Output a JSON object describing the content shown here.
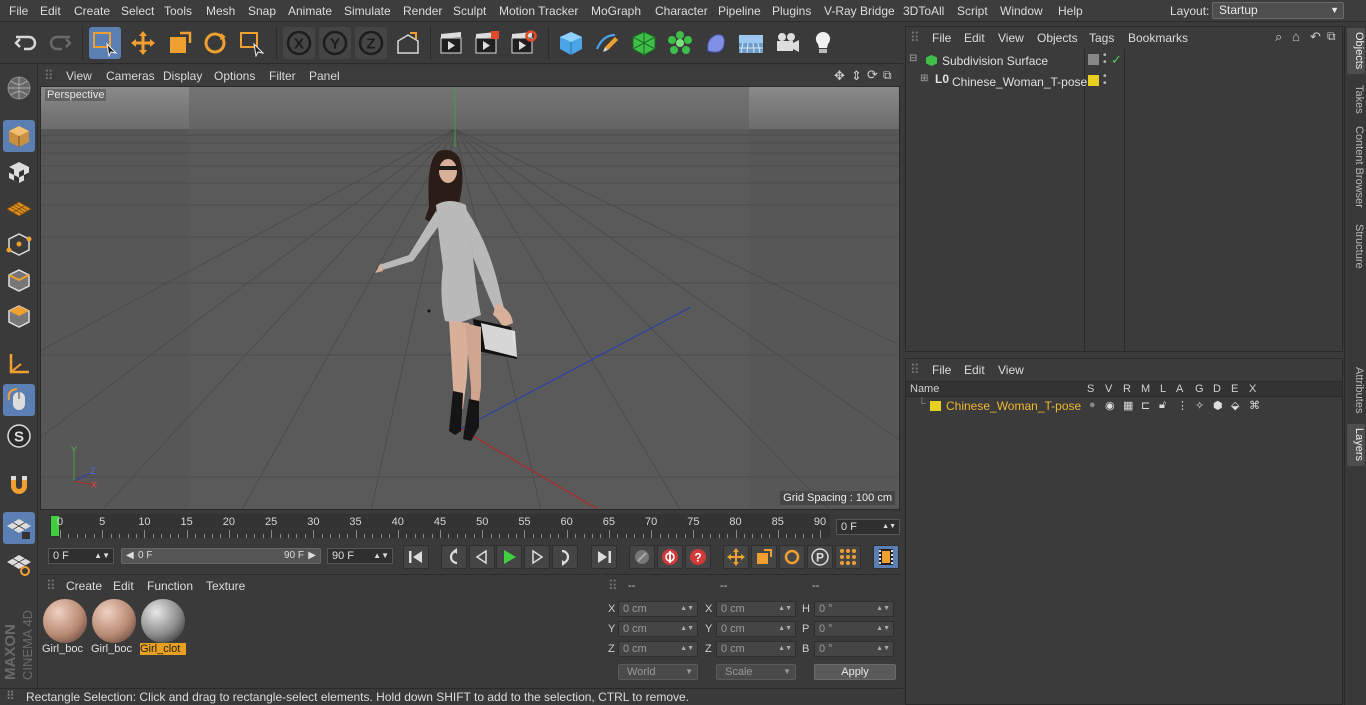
{
  "menubar": {
    "items": [
      "File",
      "Edit",
      "Create",
      "Select",
      "Tools",
      "Mesh",
      "Snap",
      "Animate",
      "Simulate",
      "Render",
      "Sculpt",
      "Motion Tracker",
      "MoGraph",
      "Character",
      "Pipeline",
      "Plugins",
      "V-Ray Bridge",
      "3DToAll",
      "Script",
      "Window",
      "Help"
    ],
    "layout_label": "Layout:",
    "layout_value": "Startup"
  },
  "toolbar": {
    "icons": [
      "undo-icon",
      "redo-icon",
      "rectangle-select-icon",
      "move-icon",
      "scale-icon",
      "rotate-icon",
      "live-select-icon",
      "x-axis-icon",
      "y-axis-icon",
      "z-axis-icon",
      "coordinate-system-icon",
      "render-view-icon",
      "render-picture-viewer-icon",
      "render-settings-icon",
      "cube-icon",
      "pen-icon",
      "subdivision-icon",
      "cloner-icon",
      "deformer-icon",
      "floor-icon",
      "camera-icon",
      "light-icon"
    ]
  },
  "viewport": {
    "menu": [
      "View",
      "Cameras",
      "Display",
      "Options",
      "Filter",
      "Panel"
    ],
    "label": "Perspective",
    "grid_spacing": "Grid Spacing : 100 cm"
  },
  "timeline": {
    "ticks": [
      "0",
      "5",
      "10",
      "15",
      "20",
      "25",
      "30",
      "35",
      "40",
      "45",
      "50",
      "55",
      "60",
      "65",
      "70",
      "75",
      "80",
      "85",
      "90"
    ],
    "current_frame": "0 F"
  },
  "transport": {
    "start_frame": "0 F",
    "range_start": "0 F",
    "range_end": "90 F",
    "end_frame": "90 F"
  },
  "materials": {
    "menu": [
      "Create",
      "Edit",
      "Function",
      "Texture"
    ],
    "items": [
      {
        "label": "Girl_boc",
        "selected": false
      },
      {
        "label": "Girl_boc",
        "selected": false
      },
      {
        "label": "Girl_clot",
        "selected": true
      }
    ]
  },
  "coordinates": {
    "headers": [
      "--",
      "--",
      "--"
    ],
    "pos": [
      {
        "axis": "X",
        "value": "0 cm"
      },
      {
        "axis": "Y",
        "value": "0 cm"
      },
      {
        "axis": "Z",
        "value": "0 cm"
      }
    ],
    "size": [
      {
        "axis": "X",
        "value": "0 cm"
      },
      {
        "axis": "Y",
        "value": "0 cm"
      },
      {
        "axis": "Z",
        "value": "0 cm"
      }
    ],
    "rot": [
      {
        "axis": "H",
        "value": "0 °"
      },
      {
        "axis": "P",
        "value": "0 °"
      },
      {
        "axis": "B",
        "value": "0 °"
      }
    ],
    "mode_world": "World",
    "mode_scale": "Scale",
    "apply": "Apply"
  },
  "object_manager": {
    "menu": [
      "File",
      "Edit",
      "View",
      "Objects",
      "Tags",
      "Bookmarks"
    ],
    "objects": [
      {
        "name": "Subdivision Surface"
      },
      {
        "name": "Chinese_Woman_T-pose"
      }
    ]
  },
  "layer_manager": {
    "menu": [
      "File",
      "Edit",
      "View"
    ],
    "columns": [
      "Name",
      "S",
      "V",
      "R",
      "M",
      "L",
      "A",
      "G",
      "D",
      "E",
      "X"
    ],
    "layer_name": "Chinese_Woman_T-pose",
    "layer_color": "#e8d020"
  },
  "right_tabs": [
    "Objects",
    "Takes",
    "Content Browser",
    "Structure",
    "Attributes",
    "Layers"
  ],
  "status": "Rectangle Selection: Click and drag to rectangle-select elements. Hold down SHIFT to add to the selection, CTRL to remove.",
  "branding": {
    "maxon": "MAXON",
    "product": "CINEMA 4D"
  },
  "colors": {
    "accent": "#5b7fb3",
    "playhead": "#3fcf3f",
    "selected_material": "#e8a020"
  }
}
